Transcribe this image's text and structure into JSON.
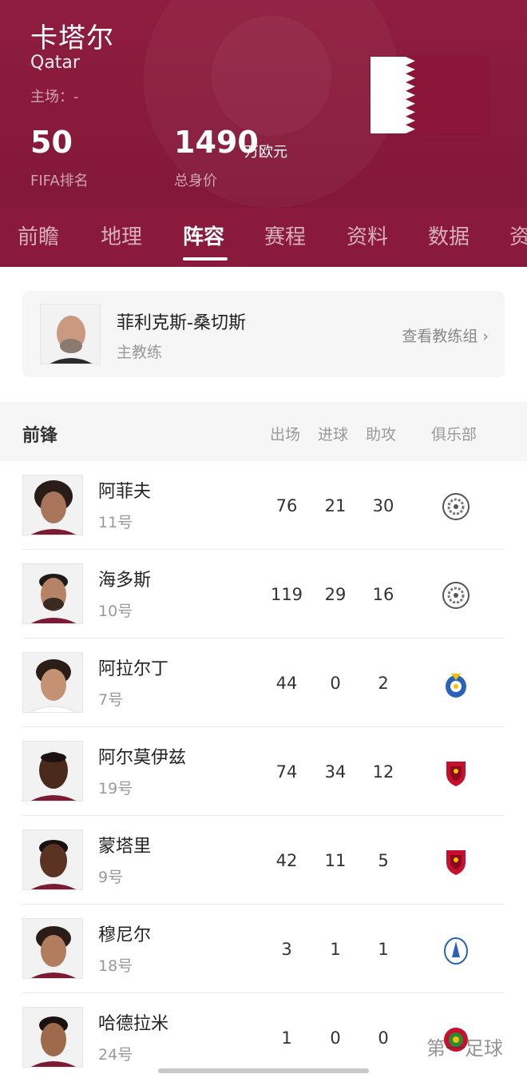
{
  "team": {
    "name": "卡塔尔",
    "name_en": "Qatar",
    "home": "主场：-",
    "fifa_rank": "50",
    "fifa_rank_label": "FIFA排名",
    "value": "1490",
    "value_unit": "万欧元",
    "value_label": "总身价"
  },
  "tabs": [
    "前瞻",
    "地理",
    "阵容",
    "赛程",
    "资料",
    "数据",
    "资"
  ],
  "active_tab": "阵容",
  "coach": {
    "name": "菲利克斯-桑切斯",
    "role": "主教练",
    "link": "查看教练组 ›"
  },
  "squad": {
    "section_title": "前锋",
    "columns": [
      "出场",
      "进球",
      "助攻",
      "俱乐部"
    ],
    "players": [
      {
        "name": "阿菲夫",
        "number": "11号",
        "apps": "76",
        "goals": "21",
        "assists": "30",
        "club_icon": "al-sadd-crest-icon"
      },
      {
        "name": "海多斯",
        "number": "10号",
        "apps": "119",
        "goals": "29",
        "assists": "16",
        "club_icon": "al-sadd-crest-icon"
      },
      {
        "name": "阿拉尔丁",
        "number": "7号",
        "apps": "44",
        "goals": "0",
        "assists": "2",
        "club_icon": "al-gharafa-crest-icon"
      },
      {
        "name": "阿尔莫伊兹",
        "number": "19号",
        "apps": "74",
        "goals": "34",
        "assists": "12",
        "club_icon": "al-duhail-crest-icon"
      },
      {
        "name": "蒙塔里",
        "number": "9号",
        "apps": "42",
        "goals": "11",
        "assists": "5",
        "club_icon": "al-duhail-crest-icon"
      },
      {
        "name": "穆尼尔",
        "number": "18号",
        "apps": "3",
        "goals": "1",
        "assists": "1",
        "club_icon": "al-wakrah-crest-icon"
      },
      {
        "name": "哈德拉米",
        "number": "24号",
        "apps": "1",
        "goals": "0",
        "assists": "0",
        "club_icon": "al-arabi-crest-icon"
      }
    ]
  },
  "watermark": "第一足球",
  "colors": {
    "brand": "#8a1a3b",
    "flag_maroon": "#8b1538"
  }
}
